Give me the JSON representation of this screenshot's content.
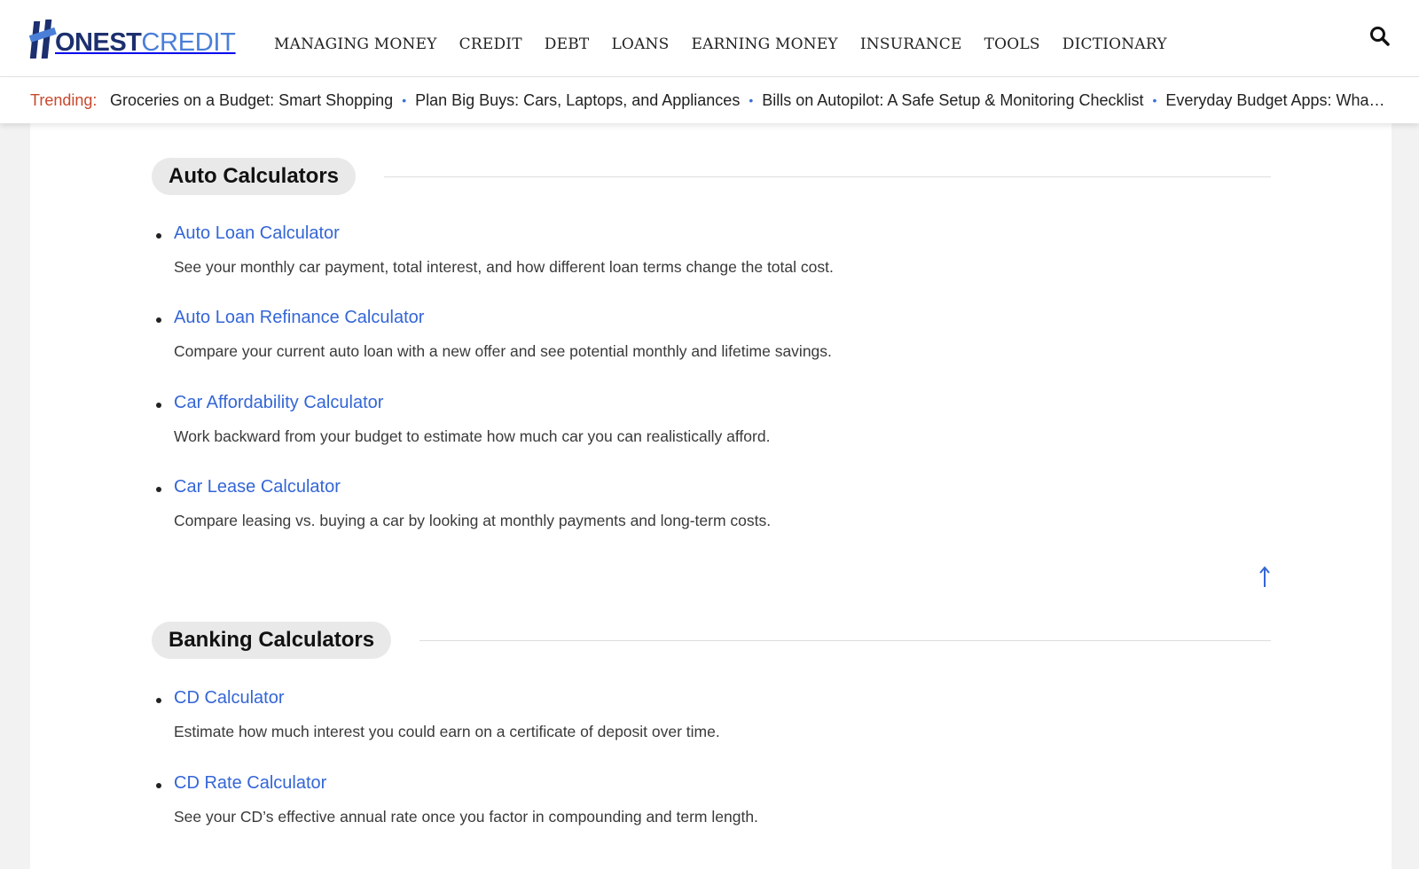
{
  "brand": {
    "name_bold": "ONEST",
    "name_light": "CREDIT",
    "colors": {
      "navy": "#1c2f6e",
      "blue": "#4a7fd8",
      "link": "#3466d6",
      "trending": "#c9472d"
    }
  },
  "nav": {
    "items": [
      {
        "label": "MANAGING MONEY"
      },
      {
        "label": "CREDIT"
      },
      {
        "label": "DEBT"
      },
      {
        "label": "LOANS"
      },
      {
        "label": "EARNING MONEY"
      },
      {
        "label": "INSURANCE"
      },
      {
        "label": "TOOLS"
      },
      {
        "label": "DICTIONARY"
      }
    ],
    "search_icon": "search-icon"
  },
  "trending": {
    "label": "Trending:",
    "items": [
      {
        "label": "Groceries on a Budget: Smart Shopping"
      },
      {
        "label": "Plan Big Buys: Cars, Laptops, and Appliances"
      },
      {
        "label": "Bills on Autopilot: A Safe Setup & Monitoring Checklist"
      },
      {
        "label": "Everyday Budget Apps: What…"
      }
    ]
  },
  "sections": [
    {
      "title": "Auto Calculators",
      "items": [
        {
          "label": "Auto Loan Calculator",
          "desc": "See your monthly car payment, total interest, and how different loan terms change the total cost."
        },
        {
          "label": "Auto Loan Refinance Calculator",
          "desc": "Compare your current auto loan with a new offer and see potential monthly and lifetime savings."
        },
        {
          "label": "Car Affordability Calculator",
          "desc": "Work backward from your budget to estimate how much car you can realistically afford."
        },
        {
          "label": "Car Lease Calculator",
          "desc": "Compare leasing vs. buying a car by looking at monthly payments and long-term costs."
        }
      ]
    },
    {
      "title": "Banking Calculators",
      "items": [
        {
          "label": "CD Calculator",
          "desc": "Estimate how much interest you could earn on a certificate of deposit over time."
        },
        {
          "label": "CD Rate Calculator",
          "desc": "See your CD’s effective annual rate once you factor in compounding and term length."
        }
      ]
    }
  ],
  "back_to_top_icon": "arrow-up-icon"
}
